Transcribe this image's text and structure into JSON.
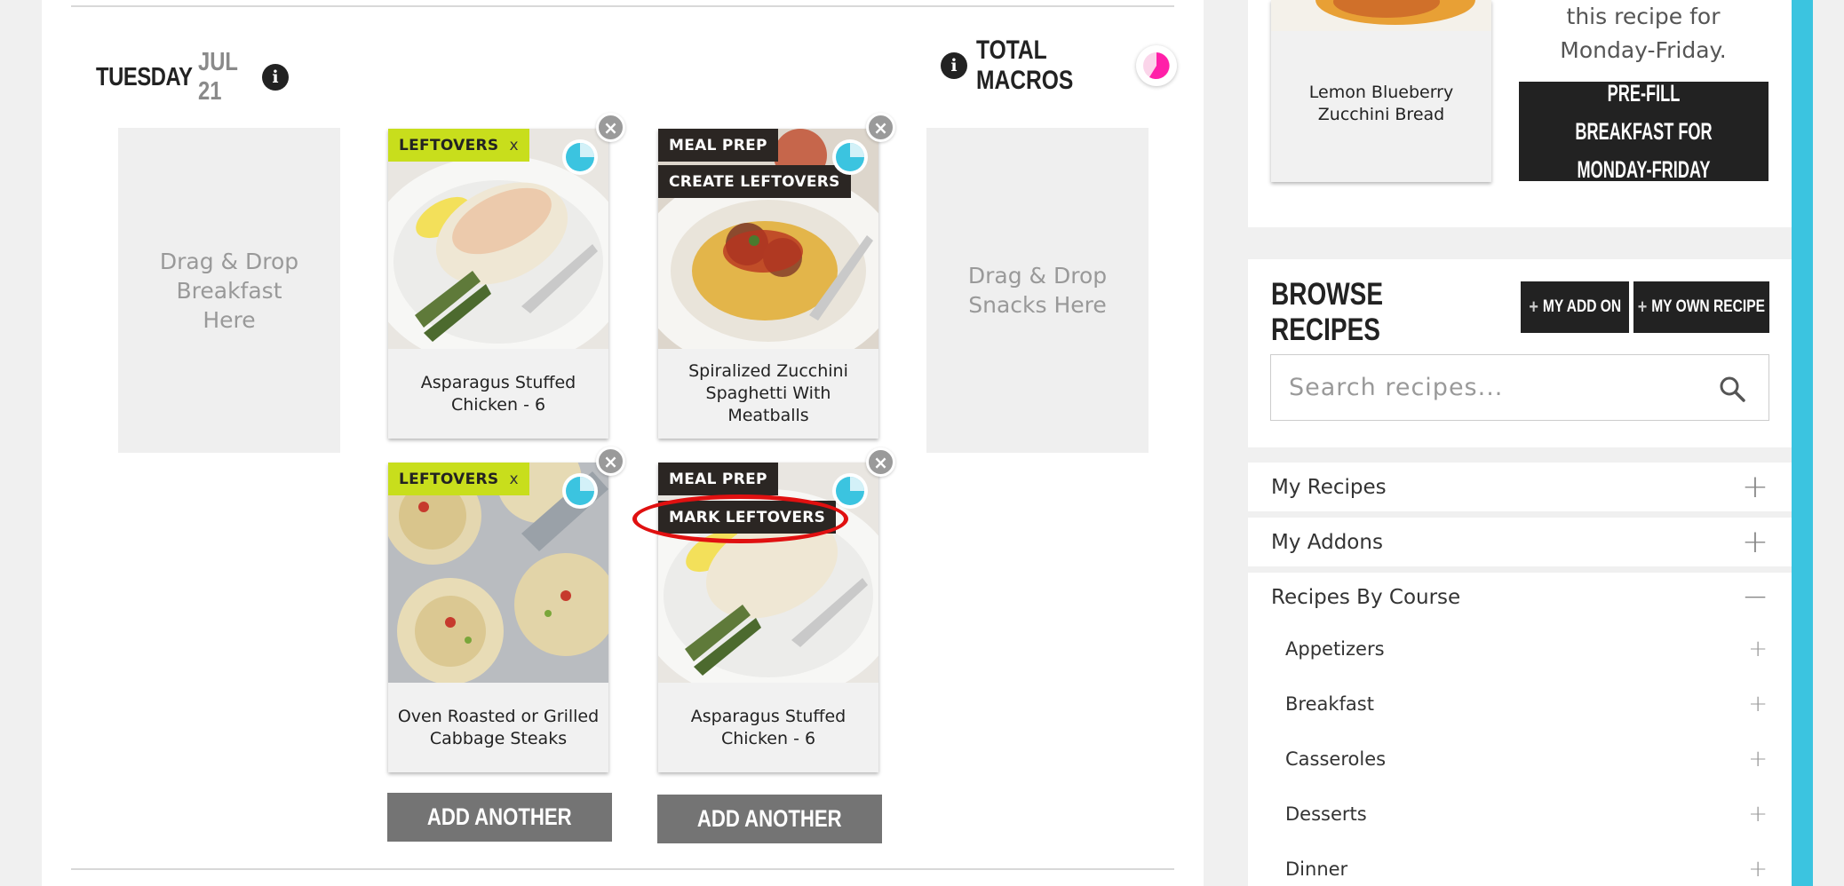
{
  "day": {
    "name": "TUESDAY",
    "date": "JUL 21"
  },
  "macros": {
    "label": "TOTAL MACROS"
  },
  "drop_zones": {
    "breakfast": "Drag & Drop Breakfast Here",
    "snacks": "Drag & Drop Snacks Here"
  },
  "cards": [
    {
      "title": "Asparagus Stuffed Chicken - 6",
      "tags": [
        "LEFTOVERS"
      ],
      "tag_close": "x"
    },
    {
      "title": "Spiralized Zucchini Spaghetti With Meatballs",
      "tags": [
        "MEAL PREP",
        "CREATE LEFTOVERS"
      ]
    },
    {
      "title": "Oven Roasted or Grilled Cabbage Steaks",
      "tags": [
        "LEFTOVERS"
      ],
      "tag_close": "x"
    },
    {
      "title": "Asparagus Stuffed Chicken - 6",
      "tags": [
        "MEAL PREP",
        "MARK LEFTOVERS"
      ]
    }
  ],
  "add_another_label": "ADD ANOTHER",
  "sidebar": {
    "mini_card_title": "Lemon Blueberry Zucchini Bread",
    "prefill_text_line1": "this recipe for",
    "prefill_text_line2": "Monday-Friday.",
    "prefill_button_line1": "PRE-FILL BREAKFAST FOR",
    "prefill_button_line2": "MONDAY-FRIDAY",
    "browse_title": "BROWSE RECIPES",
    "my_add_on_label": "MY ADD ON",
    "my_own_recipe_label": "MY OWN RECIPE",
    "search_placeholder": "Search recipes...",
    "sections": [
      {
        "label": "My Recipes",
        "toggle": "+"
      },
      {
        "label": "My Addons",
        "toggle": "+"
      },
      {
        "label": "Recipes By Course",
        "toggle": "−"
      }
    ],
    "course_items": [
      {
        "label": "Appetizers"
      },
      {
        "label": "Breakfast"
      },
      {
        "label": "Casseroles"
      },
      {
        "label": "Desserts"
      },
      {
        "label": "Dinner"
      }
    ]
  },
  "colors": {
    "leftovers_tag": "#c8de1c",
    "dark_tag": "#2b2623",
    "accent_cyan": "#3bc4e0",
    "macros_pink": "#ff1fa8",
    "highlight_red": "#e01010"
  }
}
